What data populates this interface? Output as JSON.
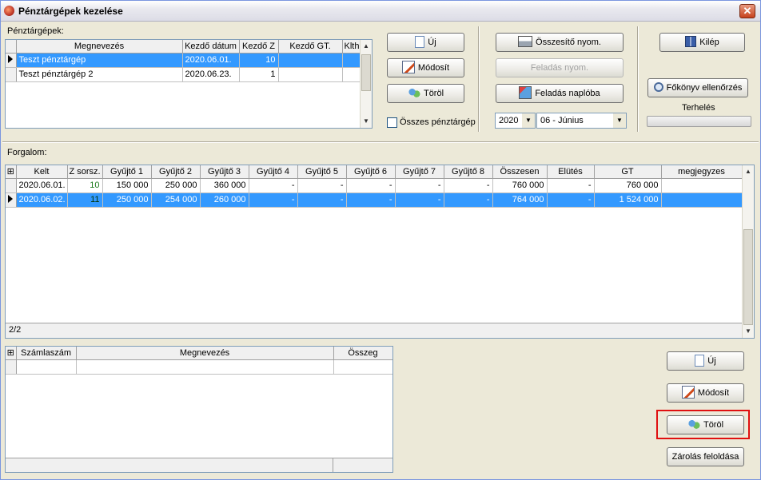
{
  "window": {
    "title": "Pénztárgépek kezelése",
    "close_label": "✕"
  },
  "registers": {
    "label": "Pénztárgépek:",
    "columns": [
      "Megnevezés",
      "Kezdő dátum",
      "Kezdő Z",
      "Kezdő GT.",
      "Klth"
    ],
    "rows": [
      {
        "name": "Teszt pénztárgép",
        "date": "2020.06.01.",
        "z": "10",
        "gt": "",
        "klth": "",
        "selected": true
      },
      {
        "name": "Teszt pénztárgép 2",
        "date": "2020.06.23.",
        "z": "1",
        "gt": "",
        "klth": "",
        "selected": false
      }
    ],
    "btn_new": "Új",
    "btn_edit": "Módosít",
    "btn_delete": "Töröl",
    "all_registers_label": "Összes pénztárgép"
  },
  "reports": {
    "btn_summary_print": "Összesítő nyom.",
    "btn_post_print": "Feladás nyom.",
    "btn_post_journal": "Feladás naplóba",
    "year": "2020",
    "month": "06 - Június"
  },
  "right": {
    "btn_exit": "Kilép",
    "btn_ledger_check": "Főkönyv ellenőrzés",
    "debit_label": "Terhelés"
  },
  "traffic": {
    "label": "Forgalom:",
    "columns": [
      "Kelt",
      "Z sorsz.",
      "Gyűjtő 1",
      "Gyűjtő 2",
      "Gyűjtő 3",
      "Gyűjtő 4",
      "Gyűjtő 5",
      "Gyűjtő 6",
      "Gyűjtő 7",
      "Gyűjtő 8",
      "Összesen",
      "Elütés",
      "GT",
      "megjegyzes"
    ],
    "rows": [
      {
        "cells": [
          "2020.06.01.",
          "10",
          "150 000",
          "250 000",
          "360 000",
          "-",
          "-",
          "-",
          "-",
          "-",
          "760 000",
          "-",
          "760 000",
          ""
        ],
        "selected": false
      },
      {
        "cells": [
          "2020.06.02.",
          "11",
          "250 000",
          "254 000",
          "260 000",
          "-",
          "-",
          "-",
          "-",
          "-",
          "764 000",
          "-",
          "1 524 000",
          ""
        ],
        "selected": true
      }
    ],
    "footer": "2/2"
  },
  "invoices": {
    "columns": [
      "Számlaszám",
      "Megnevezés",
      "Összeg"
    ],
    "btn_new": "Új",
    "btn_edit": "Módosít",
    "btn_delete": "Töröl",
    "btn_unlock": "Zárolás feloldása"
  }
}
